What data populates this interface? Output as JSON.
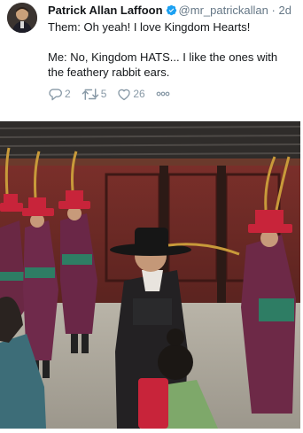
{
  "tweet": {
    "display_name": "Patrick Allan Laffoon",
    "handle": "@mr_patrickallan",
    "separator": "·",
    "time": "2d",
    "text_line1": "Them: Oh yeah! I love Kingdom Hearts!",
    "text_line2": "Me: No, Kingdom HATS... I like the ones with the feathery rabbit ears.",
    "reply_count": "2",
    "retweet_count": "5",
    "like_count": "26"
  },
  "icons": {
    "avatar": "profile-photo",
    "verified": "verified-badge-icon",
    "reply": "reply-icon",
    "retweet": "retweet-icon",
    "like": "heart-icon",
    "more": "more-dots-icon"
  },
  "colors": {
    "verified_blue": "#1da1f2",
    "muted_text": "#657786",
    "action_gray": "#8899a6"
  }
}
